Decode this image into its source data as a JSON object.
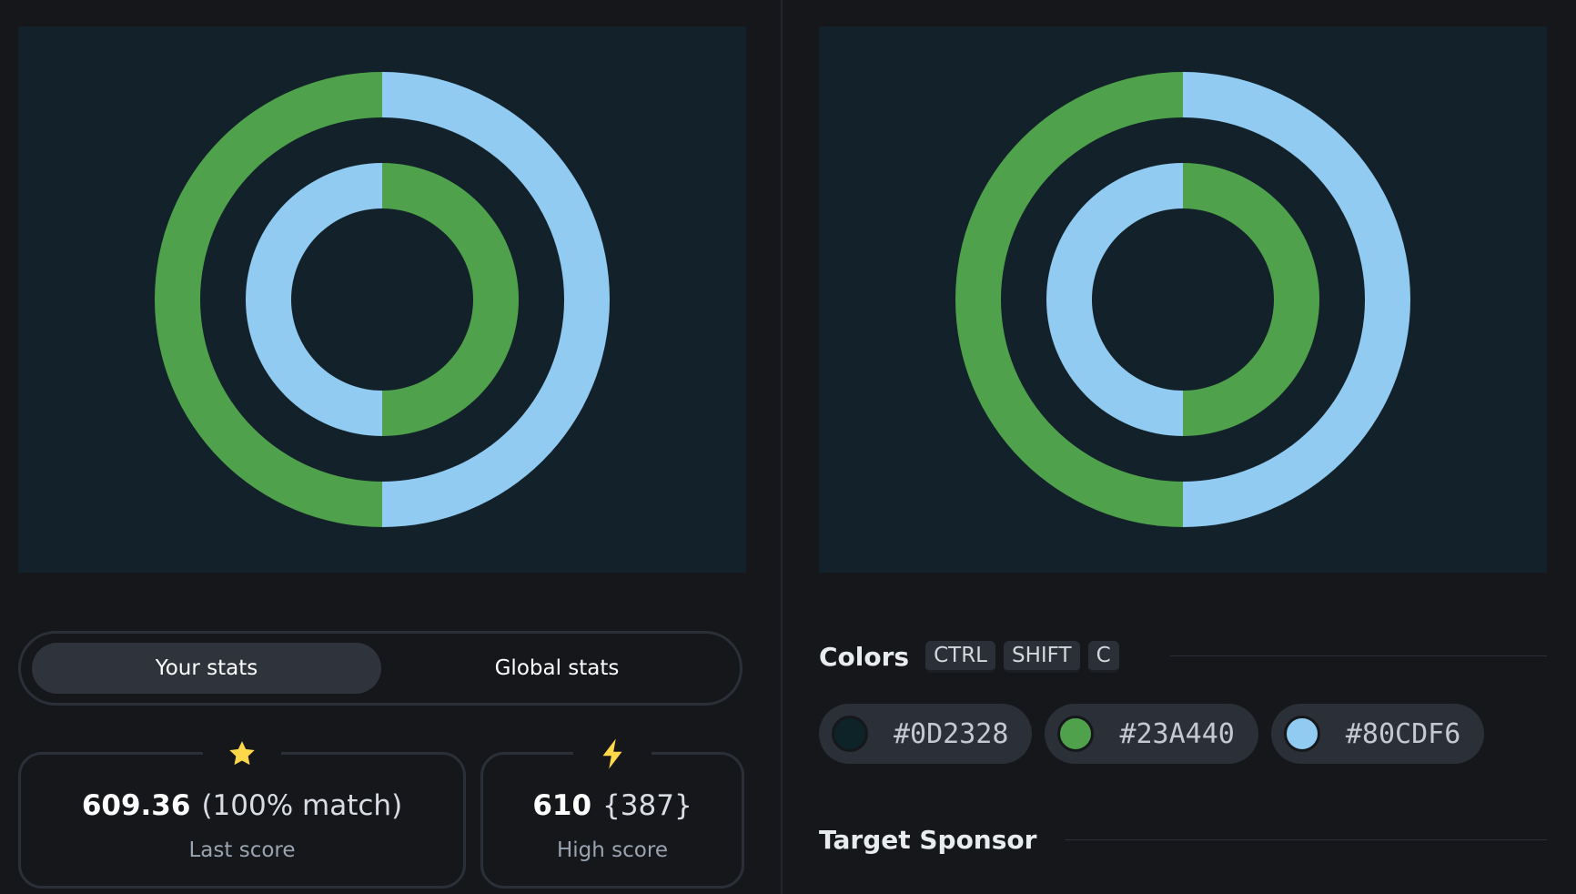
{
  "canvases": {
    "background": "#13212a",
    "green": "#4fa24b",
    "blue": "#92cbf1"
  },
  "stats_toggle": {
    "options": [
      "Your stats",
      "Global stats"
    ],
    "active": "Your stats"
  },
  "last_score": {
    "icon": "star-icon",
    "icon_color": "#ffd84a",
    "value": "609.36",
    "detail": "(100% match)",
    "label": "Last score"
  },
  "high_score": {
    "icon": "lightning-icon",
    "icon_color": "#ffd84a",
    "value": "610",
    "detail": "{387}",
    "label": "High score"
  },
  "colors_section": {
    "title": "Colors",
    "shortcut_keys": [
      "CTRL",
      "SHIFT",
      "C"
    ],
    "swatches": [
      {
        "hex": "#0D2328",
        "color": "#0d2328"
      },
      {
        "hex": "#23A440",
        "color": "#4fa24b"
      },
      {
        "hex": "#80CDF6",
        "color": "#92cbf1"
      }
    ]
  },
  "sponsor_section": {
    "title": "Target Sponsor"
  }
}
